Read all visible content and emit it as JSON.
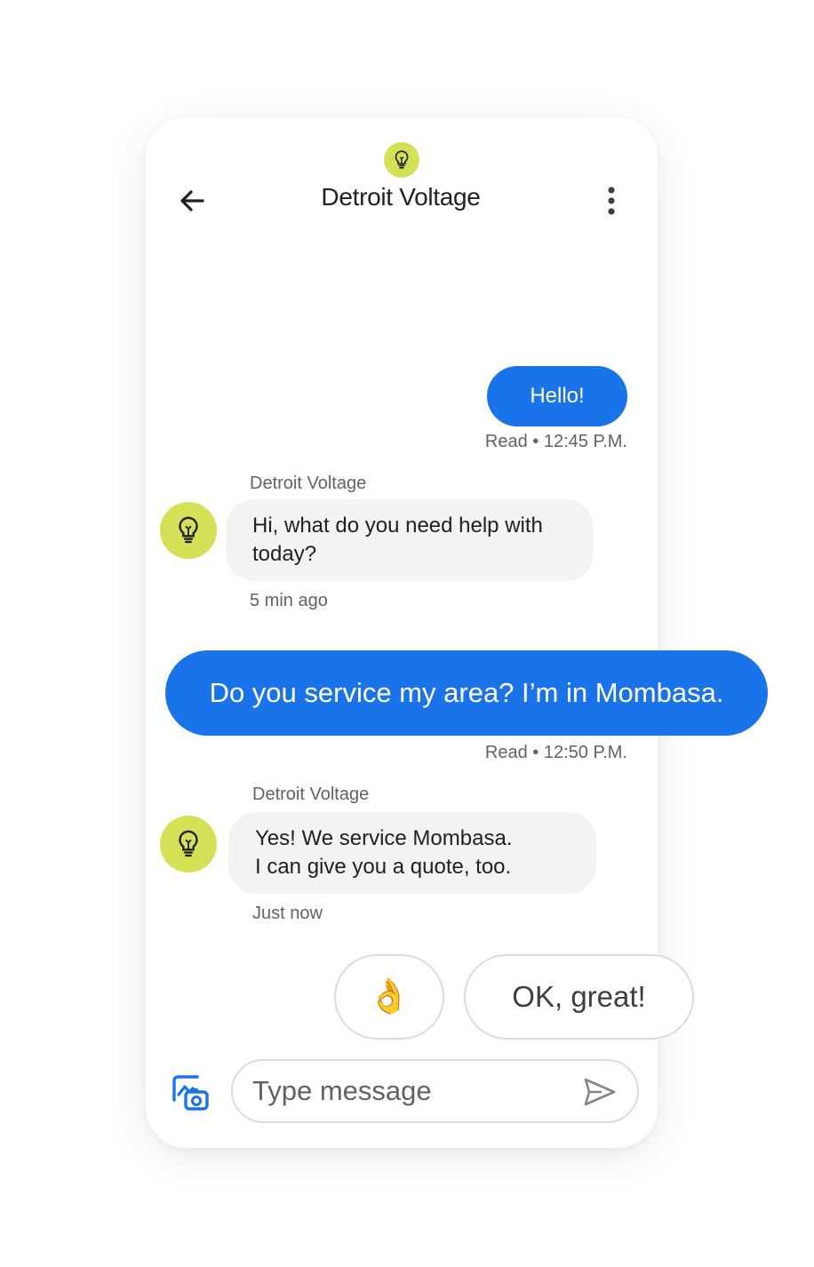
{
  "header": {
    "title": "Detroit Voltage",
    "back_icon": "arrow-back-icon",
    "menu_icon": "more-vert-icon",
    "avatar_icon": "lightbulb-icon"
  },
  "messages": [
    {
      "direction": "outgoing",
      "text": "Hello!",
      "status": "Read • 12:45 P.M."
    },
    {
      "direction": "incoming",
      "sender": "Detroit Voltage",
      "lines": [
        "Hi, what do you need help with",
        "today?"
      ],
      "time": "5 min ago"
    },
    {
      "direction": "outgoing",
      "text": "Do you service my area? I’m in Mombasa.",
      "status": "Read • 12:50 P.M."
    },
    {
      "direction": "incoming",
      "sender": "Detroit Voltage",
      "lines": [
        "Yes! We service Mombasa.",
        "I can give you a quote, too."
      ],
      "time": "Just now"
    }
  ],
  "suggestions": [
    {
      "label": "👌",
      "icon": "ok-hand-emoji"
    },
    {
      "label": "OK, great!"
    }
  ],
  "composer": {
    "placeholder": "Type message",
    "attach_icon": "add-photo-icon",
    "send_icon": "send-icon"
  },
  "colors": {
    "accent": "#1a73e8",
    "bot_avatar": "#d4e157",
    "incoming_bubble": "#f1f3f4"
  }
}
